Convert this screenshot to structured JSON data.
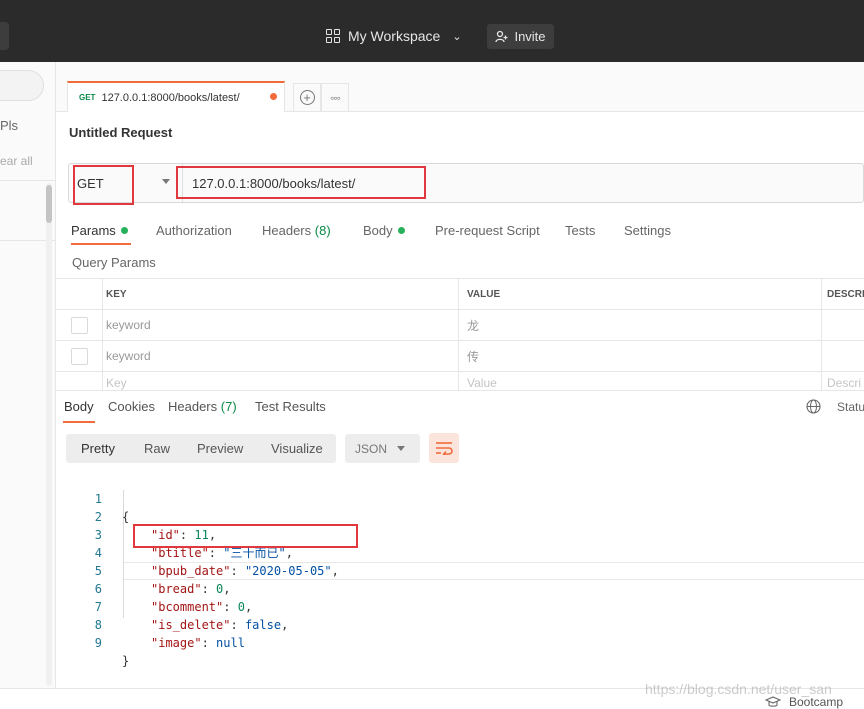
{
  "header": {
    "workspace_name": "My Workspace",
    "invite_label": "Invite"
  },
  "sidebar": {
    "apis_label": "Pls",
    "clear_all_label": "ear all"
  },
  "tab": {
    "method": "GET",
    "label": "127.0.0.1:8000/books/latest/",
    "unsaved_dot_color": "#f26b3a"
  },
  "request": {
    "title": "Untitled Request",
    "method": "GET",
    "url": "127.0.0.1:8000/books/latest/"
  },
  "request_tabs": [
    {
      "label": "Params",
      "active": true,
      "dot": true
    },
    {
      "label": "Authorization"
    },
    {
      "label": "Headers",
      "count": "(8)"
    },
    {
      "label": "Body",
      "dot": true
    },
    {
      "label": "Pre-request Script"
    },
    {
      "label": "Tests"
    },
    {
      "label": "Settings"
    }
  ],
  "query_params": {
    "title": "Query Params",
    "columns": [
      "KEY",
      "VALUE",
      "DESCRI"
    ],
    "rows": [
      {
        "key": "keyword",
        "value": "龙"
      },
      {
        "key": "keyword",
        "value": "传"
      }
    ],
    "placeholder": {
      "key": "Key",
      "value": "Value",
      "description": "Descri"
    }
  },
  "response_tabs": [
    {
      "label": "Body",
      "active": true
    },
    {
      "label": "Cookies"
    },
    {
      "label": "Headers",
      "count": "(7)"
    },
    {
      "label": "Test Results"
    }
  ],
  "response_meta": {
    "status_label": "Status"
  },
  "format": {
    "options": [
      "Pretty",
      "Raw",
      "Preview",
      "Visualize"
    ],
    "active": "Pretty",
    "language": "JSON"
  },
  "response_body": {
    "lines": [
      "{",
      "\"id\": 11,",
      "\"btitle\": \"三十而已\",",
      "\"bpub_date\": \"2020-05-05\",",
      "\"bread\": 0,",
      "\"bcomment\": 0,",
      "\"is_delete\": false,",
      "\"image\": null",
      "}"
    ]
  },
  "footer": {
    "bootcamp_label": "Bootcamp",
    "watermark": "https://blog.csdn.net/user_san"
  },
  "colors": {
    "accent": "#f26b3a",
    "highlight_box": "#e0383d",
    "topbar": "#2b2b2b",
    "success": "#26b15b"
  }
}
